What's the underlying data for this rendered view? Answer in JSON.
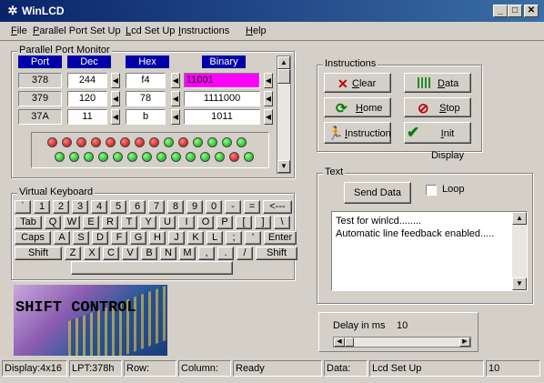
{
  "window": {
    "title": "WinLCD"
  },
  "menu": [
    "File",
    "Parallel Port Set Up",
    "Lcd Set Up",
    "Instructions",
    "Help"
  ],
  "port_monitor": {
    "label": "Parallel Port Monitor",
    "headers": [
      "Port",
      "Dec",
      "Hex",
      "Binary"
    ],
    "rows": [
      {
        "port": "378",
        "dec": "244",
        "hex": "f4",
        "bin": "11001"
      },
      {
        "port": "379",
        "dec": "120",
        "hex": "78",
        "bin": "1111000"
      },
      {
        "port": "37A",
        "dec": "11",
        "hex": "b",
        "bin": "1011"
      }
    ],
    "leds_row1": [
      "r",
      "r",
      "r",
      "r",
      "r",
      "r",
      "r",
      "r",
      "g",
      "r",
      "g",
      "g",
      "g",
      "g"
    ],
    "leds_row2": [
      "g",
      "g",
      "g",
      "g",
      "g",
      "g",
      "g",
      "g",
      "g",
      "g",
      "g",
      "g",
      "r",
      "g"
    ]
  },
  "keyboard": {
    "label": "Virtual Keyboard",
    "row1": [
      "`",
      "1",
      "2",
      "3",
      "4",
      "5",
      "6",
      "7",
      "8",
      "9",
      "0",
      "-",
      "=",
      "<---"
    ],
    "row2": [
      "Tab",
      "Q",
      "W",
      "E",
      "R",
      "T",
      "Y",
      "U",
      "I",
      "O",
      "P",
      "[",
      "]",
      "\\"
    ],
    "row3": [
      "Caps",
      "A",
      "S",
      "D",
      "F",
      "G",
      "H",
      "J",
      "K",
      "L",
      ";",
      "'",
      "Enter"
    ],
    "row4": [
      "Shift",
      "Z",
      "X",
      "C",
      "V",
      "B",
      "N",
      "M",
      ",",
      ".",
      "/",
      "Shift"
    ]
  },
  "logo_text": "SHIFT CONTROL",
  "instructions": {
    "label": "Instructions",
    "buttons": {
      "clear": "Clear",
      "data": "Data",
      "home": "Home",
      "stop": "Stop",
      "instruction": "Instruction",
      "init": "Init Display"
    }
  },
  "text_group": {
    "label": "Text",
    "send": "Send Data",
    "loop": "Loop",
    "lines": [
      "Test for winlcd........",
      "Automatic line feedback enabled....."
    ]
  },
  "delay": {
    "label": "Delay in ms",
    "value": "10"
  },
  "status": {
    "display": "Display:4x16",
    "lpt": "LPT:378h",
    "row": "Row:",
    "column": "Column:",
    "state": "Ready",
    "data": "Data:",
    "mode": "Lcd Set Up",
    "delay": "10"
  }
}
